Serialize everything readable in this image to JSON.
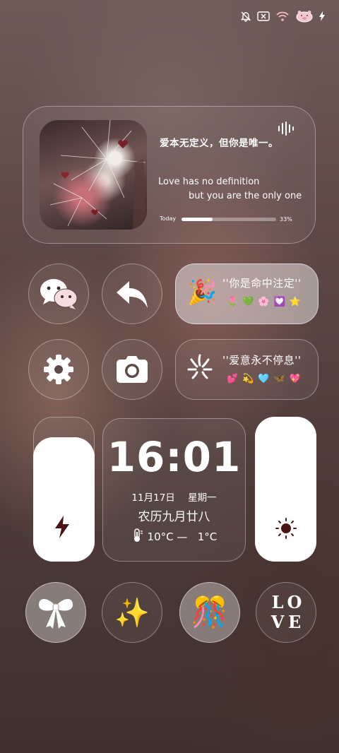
{
  "status_bar": {
    "icons": [
      "mute-bell-icon",
      "no-sim-icon",
      "wifi-icon",
      "pig-battery-icon",
      "charging-bolt-icon"
    ]
  },
  "music_widget": {
    "lyric_cn": "爱本无定义，但你是唯一。",
    "lyric_en_1": "Love has no definition",
    "lyric_en_2": "but you are the only one",
    "progress_label": "Today",
    "progress": 0.33,
    "progress_text": "33%"
  },
  "shortcuts": {
    "wechat": "wechat-icon",
    "back": "back-arrow-icon",
    "settings": "gear-icon",
    "camera": "camera-icon"
  },
  "quote_cards": [
    {
      "icon": "🎉",
      "text": "''你是命中注定''",
      "emojis": [
        "🌷",
        "💚",
        "🌸",
        "💟",
        "⭐"
      ]
    },
    {
      "icon": "sparkle-burst-icon",
      "text": "''爱意永不停息''",
      "emojis": [
        "💕",
        "💫",
        "🩵",
        "🦋",
        "💖"
      ]
    }
  ],
  "clock": {
    "time": "16:01",
    "date": "11月17日",
    "weekday": "星期一",
    "lunar": "农历九月廿八",
    "temp_high": "10°C",
    "dash": "—",
    "temp_low": "1°C"
  },
  "sliders": {
    "power_level": 0.86,
    "brightness_level": 1.0
  },
  "bottom_icons": {
    "bow": "bow-icon",
    "sparkles": "✨",
    "party": "🎊",
    "love_letters": [
      "L",
      "O",
      "V",
      "E"
    ]
  },
  "colors": {
    "accent_dark": "#4a1414",
    "glass_border": "rgba(255,255,255,0.35)"
  }
}
